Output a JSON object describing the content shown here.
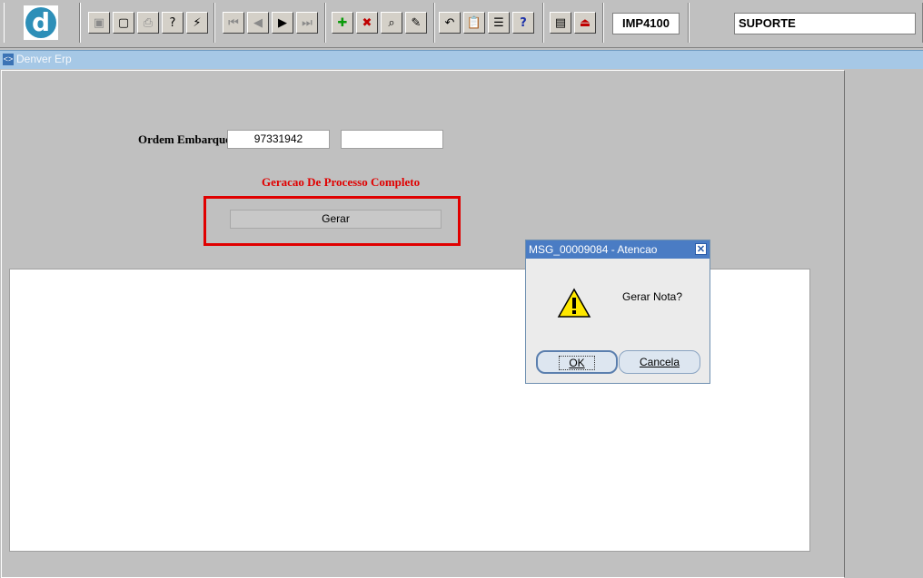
{
  "toolbar": {
    "logo_letter": "d",
    "module_code": "IMP4100",
    "user": "SUPORTE",
    "buttons": [
      {
        "name": "save-icon",
        "glyph": "▣",
        "enabled": false
      },
      {
        "name": "window-icon",
        "glyph": "▢",
        "enabled": true
      },
      {
        "name": "print-icon",
        "glyph": "⎙",
        "enabled": false
      },
      {
        "name": "query-icon",
        "glyph": "?",
        "enabled": true
      },
      {
        "name": "execute-query-icon",
        "glyph": "⚡",
        "enabled": true
      },
      {
        "name": "first-record-icon",
        "glyph": "⏮",
        "enabled": false
      },
      {
        "name": "previous-record-icon",
        "glyph": "◀",
        "enabled": false
      },
      {
        "name": "next-record-icon",
        "glyph": "▶",
        "enabled": true
      },
      {
        "name": "last-record-icon",
        "glyph": "⏭",
        "enabled": false
      },
      {
        "name": "insert-record-icon",
        "glyph": "✚",
        "enabled": true
      },
      {
        "name": "delete-record-icon",
        "glyph": "✖",
        "enabled": true
      },
      {
        "name": "search-record-icon",
        "glyph": "⌕",
        "enabled": true
      },
      {
        "name": "edit-icon",
        "glyph": "✎",
        "enabled": true
      },
      {
        "name": "undo-icon",
        "glyph": "↶",
        "enabled": true
      },
      {
        "name": "clipboard-icon",
        "glyph": "📋",
        "enabled": false
      },
      {
        "name": "list-icon",
        "glyph": "☰",
        "enabled": true
      },
      {
        "name": "help-icon",
        "glyph": "?",
        "enabled": true
      },
      {
        "name": "menu-icon",
        "glyph": "▤",
        "enabled": true
      },
      {
        "name": "exit-icon",
        "glyph": "⏏",
        "enabled": true
      }
    ]
  },
  "window": {
    "title": "Denver Erp"
  },
  "form": {
    "ordem_label": "Ordem Embarque",
    "ordem_value": "97331942",
    "secondary_value": "",
    "process_title": "Geracao De Processo Completo",
    "gerar_label": "Gerar"
  },
  "dialog": {
    "title": "MSG_00009084 - Atencao",
    "close_glyph": "✕",
    "message": "Gerar Nota?",
    "ok_label": "OK",
    "cancel_label": "Cancela"
  },
  "colors": {
    "accent_red": "#e00000",
    "title_blue": "#4a7cc4",
    "window_bar": "#a6c8e6"
  }
}
